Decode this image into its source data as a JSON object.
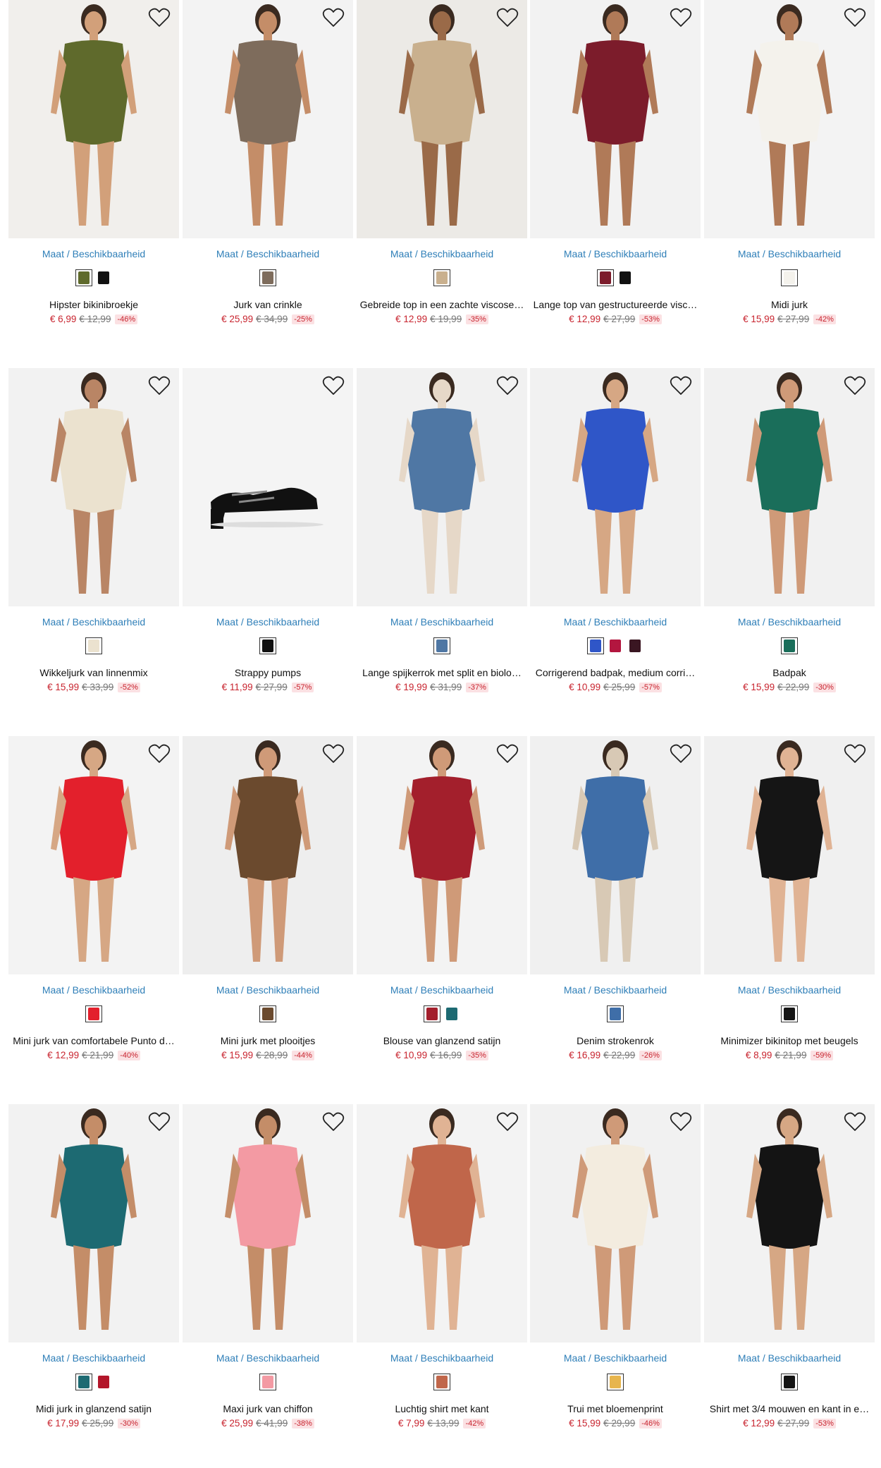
{
  "availability_label": "Maat / Beschikbaarheid",
  "products": [
    {
      "name": "Hipster bikinibroekje",
      "price": "€ 6,99",
      "old_price": "€ 12,99",
      "discount": "-46%",
      "bg": "#f1efec",
      "garment": "#5f6a2c",
      "skin": "#d2a07a",
      "swatches": [
        "#5f6a2c",
        "#111111"
      ]
    },
    {
      "name": "Jurk van crinkle",
      "price": "€ 25,99",
      "old_price": "€ 34,99",
      "discount": "-25%",
      "bg": "#f3f3f3",
      "garment": "#7e6c5c",
      "skin": "#c48d68",
      "swatches": [
        "#7e6c5c"
      ]
    },
    {
      "name": "Gebreide top in een zachte viscose…",
      "price": "€ 12,99",
      "old_price": "€ 19,99",
      "discount": "-35%",
      "bg": "#eceae6",
      "garment": "#c9b08e",
      "skin": "#9a6a48",
      "swatches": [
        "#c9b08e"
      ]
    },
    {
      "name": "Lange top van gestructureerde visc…",
      "price": "€ 12,99",
      "old_price": "€ 27,99",
      "discount": "-53%",
      "bg": "#f2f2f2",
      "garment": "#7c1c2b",
      "skin": "#b07a58",
      "swatches": [
        "#7c1c2b",
        "#111111"
      ]
    },
    {
      "name": "Midi jurk",
      "price": "€ 15,99",
      "old_price": "€ 27,99",
      "discount": "-42%",
      "bg": "#f3f3f3",
      "garment": "#f4f2ec",
      "skin": "#b07a58",
      "swatches": [
        "#f4f2ec"
      ]
    },
    {
      "name": "Wikkeljurk van linnenmix",
      "price": "€ 15,99",
      "old_price": "€ 33,99",
      "discount": "-52%",
      "bg": "#f2f2f2",
      "garment": "#ebe2cf",
      "skin": "#b98565",
      "swatches": [
        "#ebe2cf"
      ]
    },
    {
      "name": "Strappy pumps",
      "price": "€ 11,99",
      "old_price": "€ 27,99",
      "discount": "-57%",
      "bg": "#f4f4f4",
      "garment": "#111111",
      "skin": "#f4f4f4",
      "swatches": [
        "#111111"
      ]
    },
    {
      "name": "Lange spijkerrok met split en biolo…",
      "price": "€ 19,99",
      "old_price": "€ 31,99",
      "discount": "-37%",
      "bg": "#f1f1f1",
      "garment": "#4f77a4",
      "skin": "#e6d8c8",
      "swatches": [
        "#4f77a4"
      ]
    },
    {
      "name": "Corrigerend badpak, medium corri…",
      "price": "€ 10,99",
      "old_price": "€ 25,99",
      "discount": "-57%",
      "bg": "#f1f1f1",
      "garment": "#2f56c8",
      "skin": "#d6a784",
      "swatches": [
        "#2f56c8",
        "#b3163f",
        "#3a1622"
      ]
    },
    {
      "name": "Badpak",
      "price": "€ 15,99",
      "old_price": "€ 22,99",
      "discount": "-30%",
      "bg": "#f1f1f1",
      "garment": "#1a6e5a",
      "skin": "#cf9a78",
      "swatches": [
        "#1a6e5a"
      ]
    },
    {
      "name": "Mini jurk van comfortabele Punto d…",
      "price": "€ 12,99",
      "old_price": "€ 21,99",
      "discount": "-40%",
      "bg": "#f3f3f3",
      "garment": "#e3202c",
      "skin": "#d6a784",
      "swatches": [
        "#e3202c"
      ]
    },
    {
      "name": "Mini jurk met plooitjes",
      "price": "€ 15,99",
      "old_price": "€ 28,99",
      "discount": "-44%",
      "bg": "#eeeeee",
      "garment": "#6b4a2e",
      "skin": "#cf9a78",
      "swatches": [
        "#6b4a2e"
      ]
    },
    {
      "name": "Blouse van glanzend satijn",
      "price": "€ 10,99",
      "old_price": "€ 16,99",
      "discount": "-35%",
      "bg": "#f3f3f3",
      "garment": "#a31f2c",
      "skin": "#cf9a78",
      "swatches": [
        "#a31f2c",
        "#1d6a72"
      ]
    },
    {
      "name": "Denim strokenrok",
      "price": "€ 16,99",
      "old_price": "€ 22,99",
      "discount": "-26%",
      "bg": "#f0f0f0",
      "garment": "#3f6ea8",
      "skin": "#d8c9b5",
      "swatches": [
        "#3f6ea8"
      ]
    },
    {
      "name": "Minimizer bikinitop met beugels",
      "price": "€ 8,99",
      "old_price": "€ 21,99",
      "discount": "-59%",
      "bg": "#f0f0f0",
      "garment": "#151515",
      "skin": "#e0b394",
      "swatches": [
        "#151515"
      ]
    },
    {
      "name": "Midi jurk in glanzend satijn",
      "price": "€ 17,99",
      "old_price": "€ 25,99",
      "discount": "-30%",
      "bg": "#f2f2f2",
      "garment": "#1d6a72",
      "skin": "#c48d68",
      "swatches": [
        "#1d6a72",
        "#b3162a"
      ]
    },
    {
      "name": "Maxi jurk van chiffon",
      "price": "€ 25,99",
      "old_price": "€ 41,99",
      "discount": "-38%",
      "bg": "#f3f3f3",
      "garment": "#f39aa3",
      "skin": "#c48d68",
      "swatches": [
        "#f39aa3"
      ]
    },
    {
      "name": "Luchtig shirt met kant",
      "price": "€ 7,99",
      "old_price": "€ 13,99",
      "discount": "-42%",
      "bg": "#f3f3f3",
      "garment": "#c0664a",
      "skin": "#e0b394",
      "swatches": [
        "#c0664a"
      ]
    },
    {
      "name": "Trui met bloemenprint",
      "price": "€ 15,99",
      "old_price": "€ 29,99",
      "discount": "-46%",
      "bg": "#f1f1f1",
      "garment": "#f3ecdf",
      "skin": "#cf9a78",
      "swatches": [
        "#e7b54d"
      ]
    },
    {
      "name": "Shirt met 3/4 mouwen en kant in e…",
      "price": "€ 12,99",
      "old_price": "€ 27,99",
      "discount": "-53%",
      "bg": "#f2f2f2",
      "garment": "#141414",
      "skin": "#d6a784",
      "swatches": [
        "#141414"
      ]
    }
  ]
}
